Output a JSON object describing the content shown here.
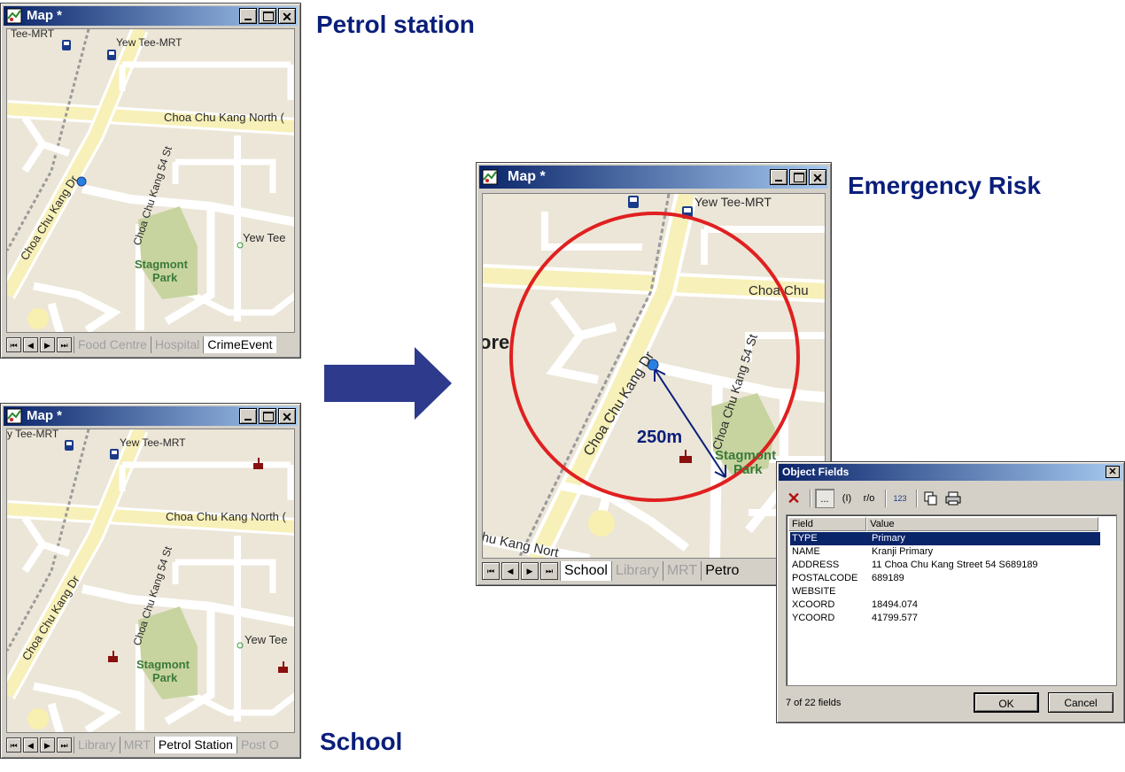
{
  "captions": {
    "petrol_station": "Petrol station",
    "school": "School",
    "emergency_risk": "Emergency Risk"
  },
  "windows": {
    "top_left": {
      "title": "Map *",
      "labels": {
        "mrt_partial": "Tee-MRT",
        "mrt": "Yew Tee-MRT",
        "road_north": "Choa Chu Kang North (",
        "road_dr": "Choa Chu Kang Dr",
        "road_54": "Choa Chu Kang 54 St",
        "yew_tee": "Yew Tee",
        "park_line1": "Stagmont",
        "park_line2": "Park"
      },
      "tabs": [
        "Food Centre",
        "Hospital",
        "CrimeEvent"
      ],
      "active_tab": 2
    },
    "bottom_left": {
      "title": "Map *",
      "labels": {
        "mrt_partial": "y Tee-MRT",
        "mrt": "Yew Tee-MRT",
        "road_north": "Choa Chu Kang North (",
        "road_dr": "Choa Chu Kang Dr",
        "road_54": "Choa Chu Kang 54 St",
        "yew_tee": "Yew Tee",
        "park_line1": "Stagmont",
        "park_line2": "Park"
      },
      "tabs": [
        "Library",
        "MRT",
        "Petrol Station",
        "Post O"
      ],
      "active_tab": 2
    },
    "center": {
      "title": "Map *",
      "labels": {
        "mrt": "Yew Tee-MRT",
        "road_north": "Choa Chu",
        "road_dr": "Choa Chu Kang Dr",
        "road_54": "Choa Chu Kang 54 St",
        "park_line1": "Stagmont",
        "park_line2": "Park",
        "ore": "ore",
        "road_bottom": "hu Kang Nort"
      },
      "radius_label": "250m",
      "tabs": [
        "School",
        "Library",
        "MRT",
        "Petro"
      ],
      "active_tab": 0
    }
  },
  "colors": {
    "caption": "#0a1e7a",
    "buffer_circle": "#e02020",
    "arrow": "#2e3a8c"
  },
  "dialog": {
    "title": "Object Fields",
    "toolbar": [
      "delete-icon",
      "...",
      "(I)",
      "r/o",
      "123",
      "copy-icon",
      "print-icon"
    ],
    "columns": [
      "Field",
      "Value"
    ],
    "rows": [
      {
        "field": "TYPE",
        "value": "Primary"
      },
      {
        "field": "NAME",
        "value": "Kranji Primary"
      },
      {
        "field": "ADDRESS",
        "value": "11 Choa Chu Kang Street 54 S689189"
      },
      {
        "field": "POSTALCODE",
        "value": "689189"
      },
      {
        "field": "WEBSITE",
        "value": ""
      },
      {
        "field": "XCOORD",
        "value": "18494.074"
      },
      {
        "field": "YCOORD",
        "value": "41799.577"
      }
    ],
    "selected_row": 0,
    "status": "7 of 22 fields",
    "ok_label": "OK",
    "cancel_label": "Cancel"
  }
}
